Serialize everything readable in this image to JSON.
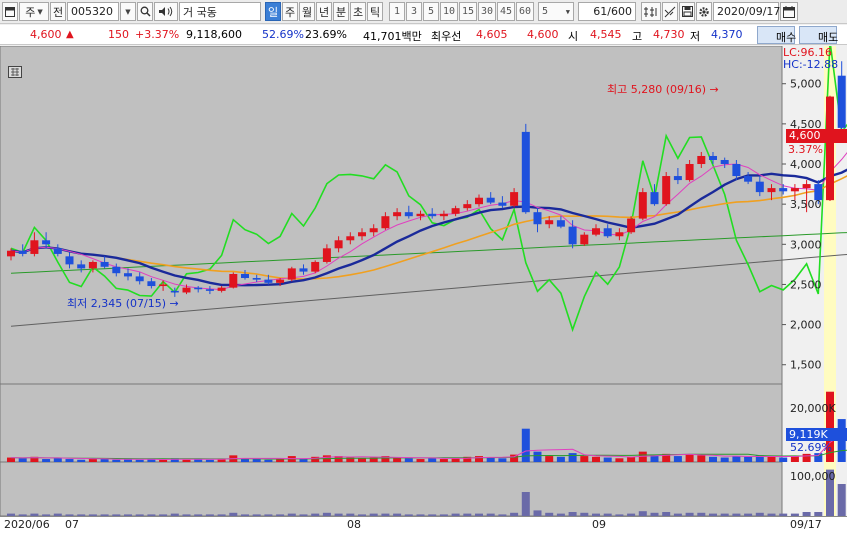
{
  "toolbar": {
    "market": "주",
    "jeon": "전",
    "code": "005320",
    "stock_name": "거 국동",
    "periods": [
      "일",
      "주",
      "월",
      "년",
      "분",
      "초",
      "틱"
    ],
    "selected_period": "일",
    "intervals": [
      "1",
      "3",
      "5",
      "10",
      "15",
      "30",
      "45",
      "60"
    ],
    "interval_select": "5",
    "count": "61",
    "count_total": "/600",
    "date": "2020/09/17"
  },
  "info": {
    "price": "4,600",
    "change": "150",
    "change_pct": "+3.37%",
    "volume": "9,118,600",
    "vol_ratio": "52.69%",
    "turnover": "23.69%",
    "amount": "41,701백만",
    "best_label": "최우선",
    "best_ask": "4,605",
    "best_bid": "4,600",
    "open_label": "시",
    "open": "4,545",
    "high_label": "고",
    "high": "4,730",
    "low_label": "저",
    "low": "4,370",
    "buy_label": "매수",
    "sell_label": "매도"
  },
  "annotations": {
    "high_note": "최고 5,280 (09/16)",
    "low_note": "최저 2,345 (07/15)",
    "lc": "LC:96.16",
    "hc": "HC:-12.88",
    "price_tag": "4,600",
    "pct_tag": "3.37%",
    "vol_tag": "9,119K",
    "vol_pct_tag": "52.69%"
  },
  "colors": {
    "up": "#e0141e",
    "down": "#1e50dc",
    "ma5": "#e040c0",
    "ma20": "#1a2a9a",
    "ma60": "#f0a020",
    "ma120": "#2a9a2a",
    "ma240": "#606060",
    "disparity": "#22dd22",
    "highlight": "#fffcc0",
    "background": "#c0c0c0"
  },
  "chart_data": {
    "type": "candlestick",
    "yticks": [
      1500,
      2000,
      2500,
      3000,
      3500,
      4000,
      4500,
      5000
    ],
    "ytick_labels": [
      "1,500",
      "2,000",
      "2,500",
      "3,000",
      "3,500",
      "4,000",
      "4,500",
      "5,000"
    ],
    "vol_ticks": [
      "20,000K"
    ],
    "vol2_ticks": [
      "100,000"
    ],
    "x_labels": [
      "2020/06",
      "07",
      "08",
      "09",
      "09/17"
    ],
    "candles": [
      [
        2850,
        2950,
        2800,
        2920
      ],
      [
        2920,
        3000,
        2850,
        2880
      ],
      [
        2880,
        3150,
        2850,
        3050
      ],
      [
        3050,
        3150,
        2950,
        3000
      ],
      [
        2950,
        3000,
        2850,
        2880
      ],
      [
        2850,
        2900,
        2700,
        2750
      ],
      [
        2750,
        2800,
        2650,
        2700
      ],
      [
        2700,
        2800,
        2650,
        2780
      ],
      [
        2780,
        2850,
        2700,
        2720
      ],
      [
        2720,
        2760,
        2600,
        2640
      ],
      [
        2640,
        2700,
        2550,
        2600
      ],
      [
        2600,
        2650,
        2500,
        2540
      ],
      [
        2540,
        2580,
        2450,
        2480
      ],
      [
        2480,
        2550,
        2420,
        2500
      ],
      [
        2420,
        2460,
        2345,
        2400
      ],
      [
        2400,
        2500,
        2380,
        2460
      ],
      [
        2460,
        2480,
        2400,
        2440
      ],
      [
        2440,
        2480,
        2380,
        2420
      ],
      [
        2420,
        2480,
        2400,
        2460
      ],
      [
        2460,
        2650,
        2450,
        2630
      ],
      [
        2630,
        2680,
        2560,
        2580
      ],
      [
        2580,
        2620,
        2530,
        2560
      ],
      [
        2560,
        2620,
        2500,
        2520
      ],
      [
        2520,
        2580,
        2480,
        2560
      ],
      [
        2560,
        2720,
        2540,
        2700
      ],
      [
        2700,
        2750,
        2620,
        2660
      ],
      [
        2660,
        2800,
        2640,
        2780
      ],
      [
        2780,
        3000,
        2760,
        2950
      ],
      [
        2950,
        3100,
        2900,
        3050
      ],
      [
        3050,
        3150,
        3000,
        3100
      ],
      [
        3100,
        3200,
        3050,
        3150
      ],
      [
        3150,
        3250,
        3100,
        3200
      ],
      [
        3200,
        3400,
        3180,
        3350
      ],
      [
        3350,
        3450,
        3300,
        3400
      ],
      [
        3400,
        3480,
        3320,
        3350
      ],
      [
        3350,
        3420,
        3300,
        3380
      ],
      [
        3380,
        3450,
        3320,
        3350
      ],
      [
        3350,
        3420,
        3300,
        3380
      ],
      [
        3380,
        3480,
        3350,
        3450
      ],
      [
        3450,
        3550,
        3420,
        3500
      ],
      [
        3500,
        3620,
        3470,
        3580
      ],
      [
        3580,
        3650,
        3500,
        3520
      ],
      [
        3520,
        3600,
        3450,
        3480
      ],
      [
        3480,
        3700,
        3460,
        3650
      ],
      [
        4400,
        4500,
        3380,
        3400
      ],
      [
        3400,
        3450,
        3150,
        3250
      ],
      [
        3250,
        3350,
        3200,
        3300
      ],
      [
        3300,
        3350,
        3200,
        3220
      ],
      [
        3220,
        3300,
        2950,
        3000
      ],
      [
        3000,
        3150,
        2980,
        3120
      ],
      [
        3120,
        3250,
        3100,
        3200
      ],
      [
        3200,
        3250,
        3080,
        3100
      ],
      [
        3100,
        3200,
        3050,
        3150
      ],
      [
        3150,
        3350,
        3130,
        3320
      ],
      [
        3320,
        3700,
        3300,
        3650
      ],
      [
        3650,
        3750,
        3480,
        3500
      ],
      [
        3500,
        3900,
        3480,
        3850
      ],
      [
        3850,
        3950,
        3750,
        3800
      ],
      [
        3800,
        4050,
        3780,
        4000
      ],
      [
        4000,
        4150,
        3950,
        4100
      ],
      [
        4100,
        4150,
        4000,
        4050
      ],
      [
        4050,
        4080,
        3950,
        4000
      ],
      [
        4000,
        4050,
        3800,
        3850
      ],
      [
        3850,
        3900,
        3750,
        3780
      ],
      [
        3780,
        3850,
        3600,
        3650
      ],
      [
        3650,
        3750,
        3550,
        3700
      ],
      [
        3700,
        3750,
        3620,
        3660
      ],
      [
        3660,
        3750,
        3550,
        3700
      ],
      [
        3700,
        3800,
        3400,
        3750
      ],
      [
        3750,
        3800,
        3500,
        3550
      ],
      [
        3550,
        4850,
        3540,
        4840
      ],
      [
        5100,
        5280,
        4300,
        4450
      ],
      [
        4450,
        4730,
        4370,
        4600
      ]
    ],
    "volume": [
      6,
      5,
      7,
      4,
      6,
      4,
      3,
      5,
      4,
      3,
      4,
      3,
      4,
      3,
      5,
      3,
      4,
      3,
      4,
      9,
      4,
      4,
      3,
      4,
      8,
      4,
      7,
      9,
      8,
      6,
      5,
      6,
      8,
      6,
      5,
      4,
      5,
      4,
      6,
      7,
      8,
      6,
      5,
      10,
      45,
      14,
      8,
      7,
      12,
      8,
      7,
      6,
      5,
      7,
      14,
      9,
      11,
      8,
      10,
      9,
      7,
      6,
      8,
      7,
      9,
      7,
      6,
      8,
      11,
      12,
      95,
      58,
      30
    ],
    "volume2": [
      3,
      2,
      3,
      2,
      3,
      2,
      2,
      2,
      2,
      2,
      2,
      2,
      2,
      2,
      3,
      2,
      2,
      2,
      2,
      4,
      2,
      2,
      2,
      2,
      3,
      2,
      3,
      4,
      3,
      3,
      2,
      3,
      3,
      3,
      2,
      2,
      2,
      2,
      3,
      3,
      3,
      3,
      2,
      4,
      30,
      7,
      4,
      3,
      5,
      4,
      3,
      3,
      2,
      3,
      6,
      4,
      5,
      3,
      4,
      4,
      3,
      3,
      3,
      3,
      4,
      3,
      3,
      3,
      5,
      5,
      58,
      40,
      22
    ]
  }
}
